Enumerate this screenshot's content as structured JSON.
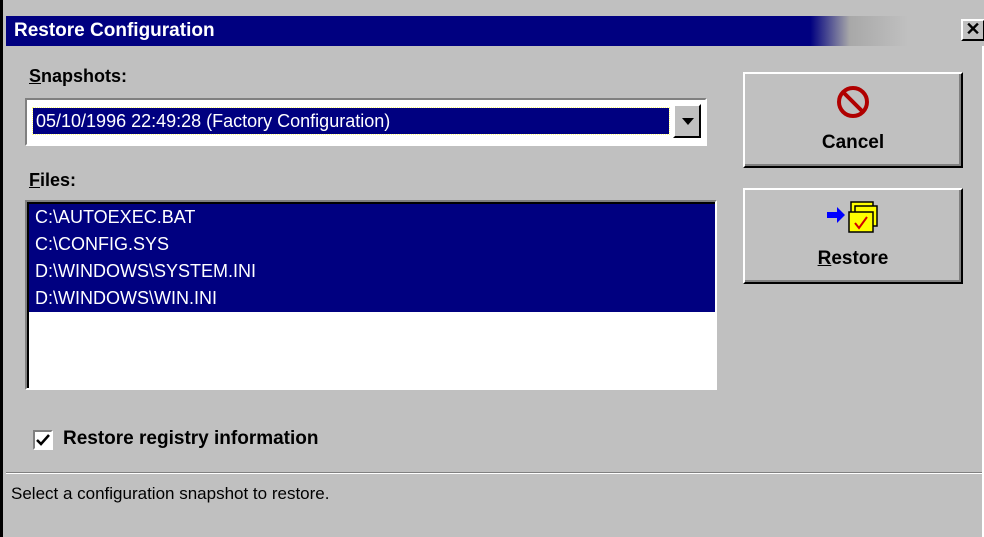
{
  "window": {
    "title": "Restore Configuration",
    "close_glyph": "✕"
  },
  "snapshots": {
    "label_accel": "S",
    "label_rest": "napshots:",
    "selected": "05/10/1996 22:49:28 (Factory Configuration)"
  },
  "files": {
    "label_accel": "F",
    "label_rest": "iles:",
    "items": [
      "C:\\AUTOEXEC.BAT",
      "C:\\CONFIG.SYS",
      "D:\\WINDOWS\\SYSTEM.INI",
      "D:\\WINDOWS\\WIN.INI"
    ]
  },
  "buttons": {
    "cancel": {
      "label": "Cancel",
      "icon": "no-entry-icon"
    },
    "restore": {
      "label_accel": "R",
      "label_rest": "estore",
      "icon": "restore-folders-icon"
    }
  },
  "options": {
    "restore_registry": {
      "label": "Restore registry information",
      "checked": true
    }
  },
  "status": {
    "text": "Select a configuration snapshot to restore."
  },
  "colors": {
    "titlebar": "#000080",
    "selection": "#000080",
    "face": "#c0c0c0",
    "cancel_icon": "#b00000",
    "arrow_blue": "#0000ff",
    "folder_yellow": "#ffff00"
  }
}
